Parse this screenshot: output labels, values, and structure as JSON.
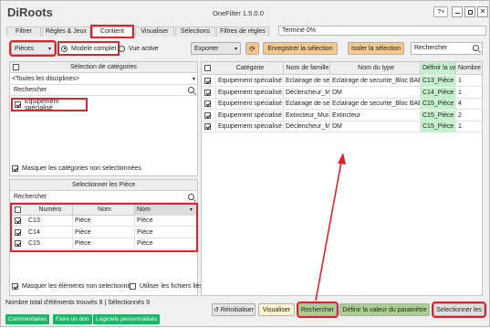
{
  "app": {
    "logo": "DiRoots",
    "title": "OneFilter 1.5.0.0",
    "help": "?"
  },
  "tabs": [
    "Filtrer",
    "Règles & Jeux",
    "Contient",
    "Visualiser",
    "Sélections",
    "Filtres de règles"
  ],
  "progress": {
    "label": "Terminé 0%",
    "value": 0
  },
  "toolbar": {
    "category_select": "Pièces",
    "radio_complete": "Modele complet",
    "radio_active": "Vue active",
    "export": "Exporter",
    "save_selection": "Enregistrer la sélection",
    "isolate": "Isoler la sélection",
    "search_placeholder": "Rechercher"
  },
  "categories": {
    "title": "Sélection de catégories",
    "disciplines": "<Toutes les disciplines>",
    "search": "Rechercher",
    "items": [
      {
        "label": "Equipement spécialisé",
        "checked": true
      }
    ],
    "hide_unselected": "Masquer les catégories non selectionnées"
  },
  "elements": {
    "title": "Selectionner les Pièce",
    "search": "Rechercher",
    "headers": [
      "Numéro",
      "Nom",
      "Nom"
    ],
    "rows": [
      [
        "C13",
        "Pièce",
        "Pièce"
      ],
      [
        "C14",
        "Pièce",
        "Pièce"
      ],
      [
        "C15",
        "Pièce",
        "Pièce"
      ]
    ],
    "hide_unselected": "Masquer les éléments non selectionnés",
    "use_links": "Utiliser les fichiers liés"
  },
  "results": {
    "headers": [
      "Catégorie",
      "Nom de famille",
      "Nom du type",
      "Définir la va",
      "Nombre"
    ],
    "rows": [
      [
        "Equipement spécialisé",
        "Eclairage de secur",
        "Eclairage de securite_Bloc BAES",
        "C13_Pièce",
        "1"
      ],
      [
        "Equipement spécialisé",
        "Déclencheur_Ma",
        "DM",
        "C14_Pièce",
        "1"
      ],
      [
        "Equipement spécialisé",
        "Eclairage de secur",
        "Eclairage de securite_Bloc BAES",
        "C15_Pièce",
        "4"
      ],
      [
        "Equipement spécialisé",
        "Extincteur_Mural",
        "Extincteur",
        "C15_Pièce",
        "2"
      ],
      [
        "Equipement spécialisé",
        "Déclencheur_Ma",
        "DM",
        "C15_Pièce",
        "1"
      ]
    ]
  },
  "status": "Nombre total d'éléments trouvés 9 | Sélectionnés 9",
  "footer_buttons": {
    "reset": "Réinitialiser",
    "visualize": "Visualiser",
    "search": "Rechercher",
    "set_param": "Définir la valeur du paramètre",
    "select": "Selectionner les"
  },
  "links": [
    "Commentaires",
    "Faire un don",
    "Logiciels personnalisés"
  ],
  "colors": {
    "accent_red": "#d9252b",
    "green_col": "#c6efce",
    "yellow_btn": "#fff2cc",
    "orange_btn": "#f5c58a",
    "link_green": "#1fb36a"
  }
}
